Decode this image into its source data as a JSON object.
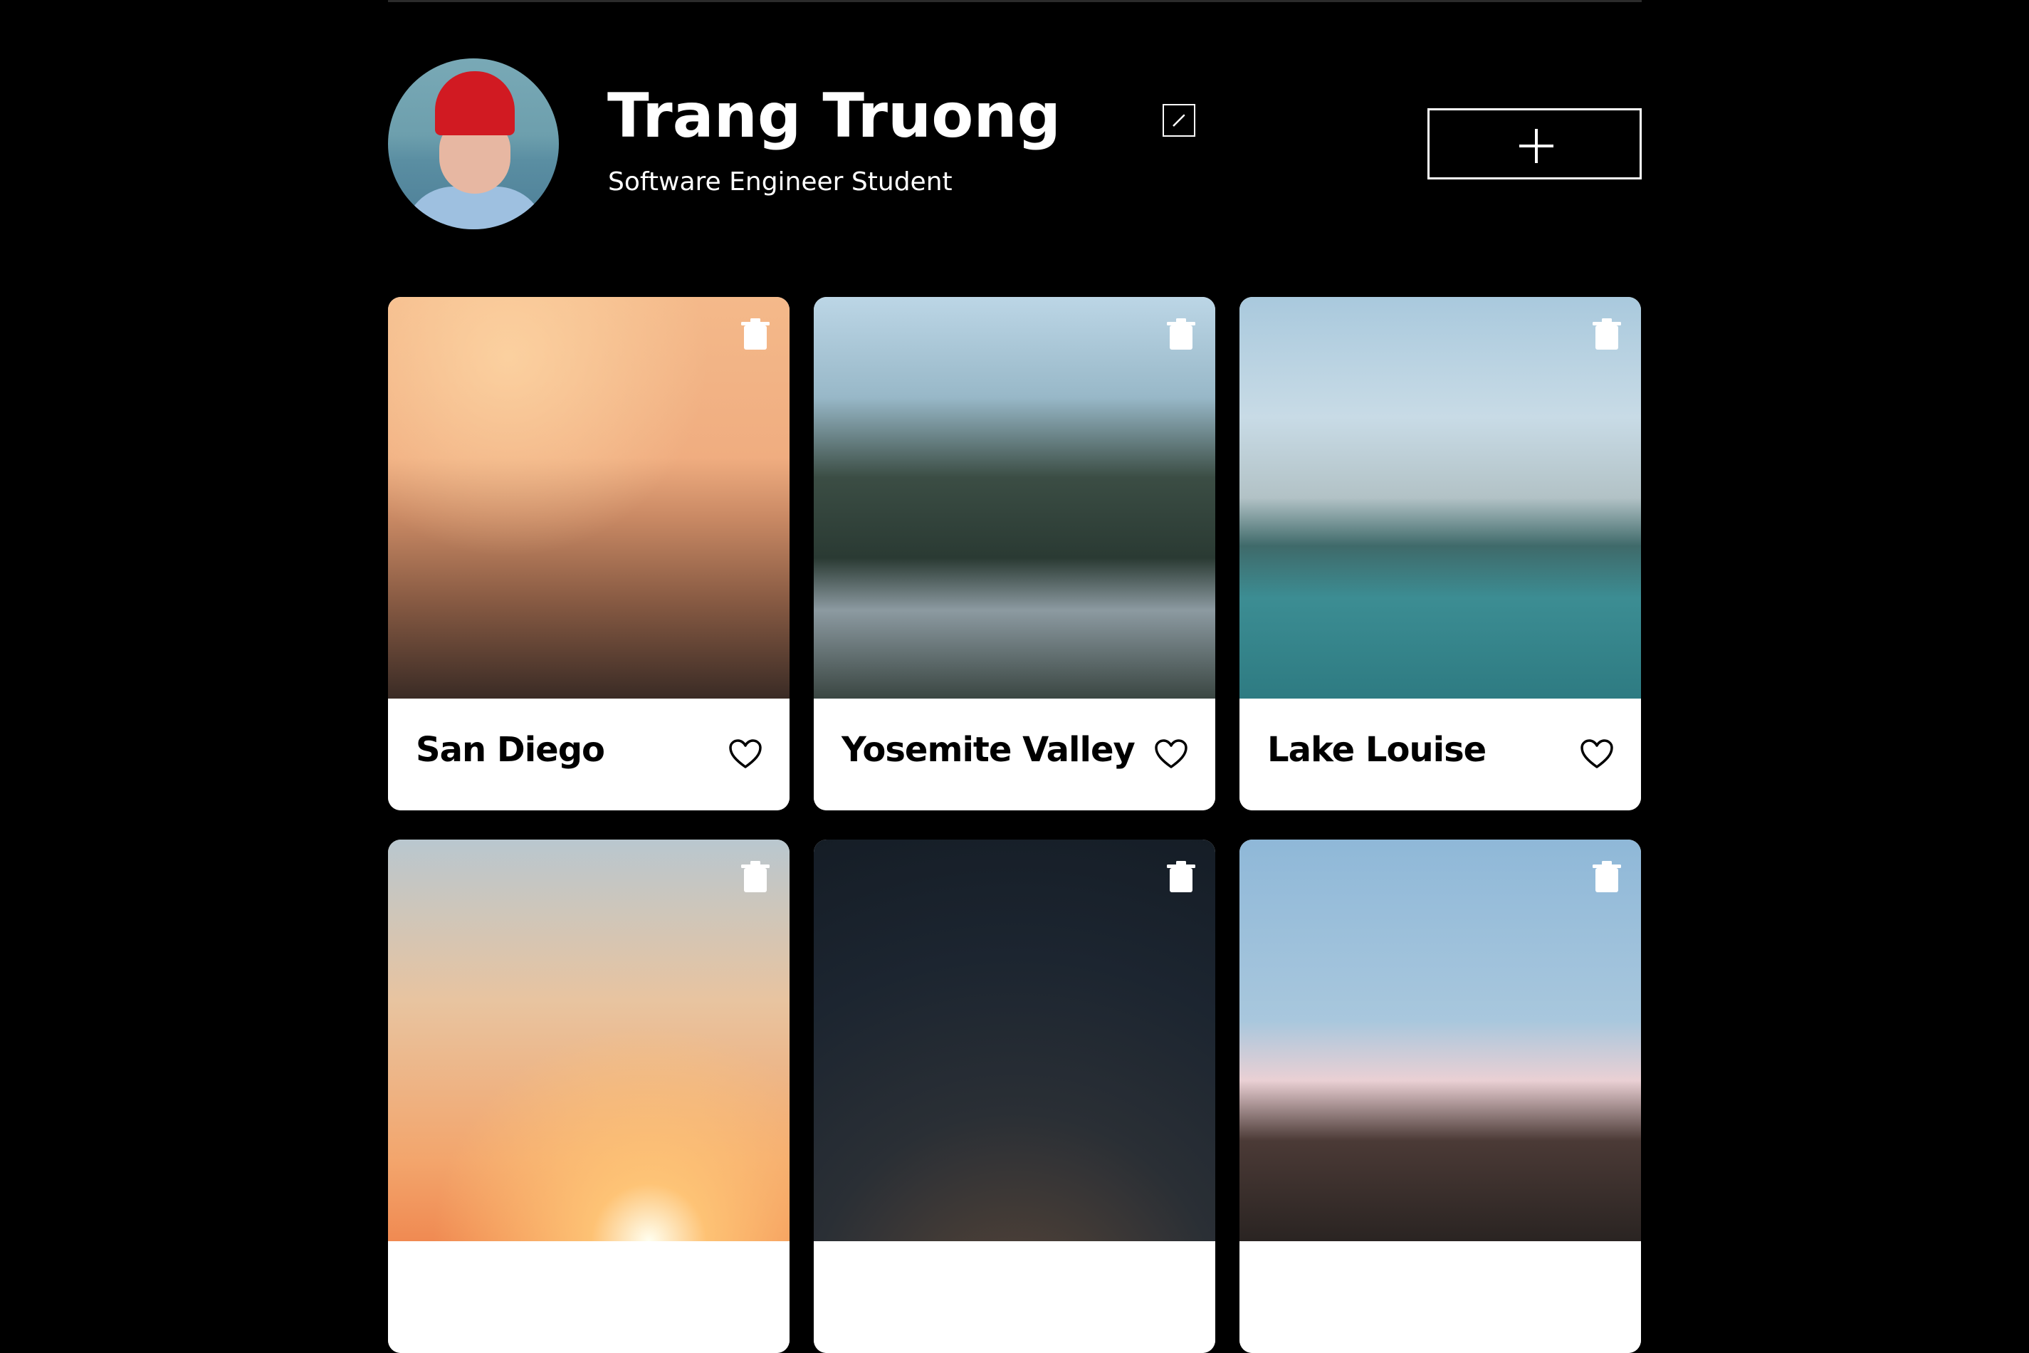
{
  "profile": {
    "name": "Trang Truong",
    "role": "Software Engineer Student",
    "edit_icon": "pencil-icon",
    "add_icon": "plus-icon"
  },
  "cards": [
    {
      "title": "San Diego",
      "liked": false
    },
    {
      "title": "Yosemite Valley",
      "liked": false
    },
    {
      "title": "Lake Louise",
      "liked": false
    },
    {
      "title": "",
      "liked": false
    },
    {
      "title": "",
      "liked": false
    },
    {
      "title": "",
      "liked": false
    }
  ],
  "colors": {
    "background": "#000000",
    "card_bg": "#ffffff",
    "text": "#ffffff",
    "card_text": "#000000"
  }
}
